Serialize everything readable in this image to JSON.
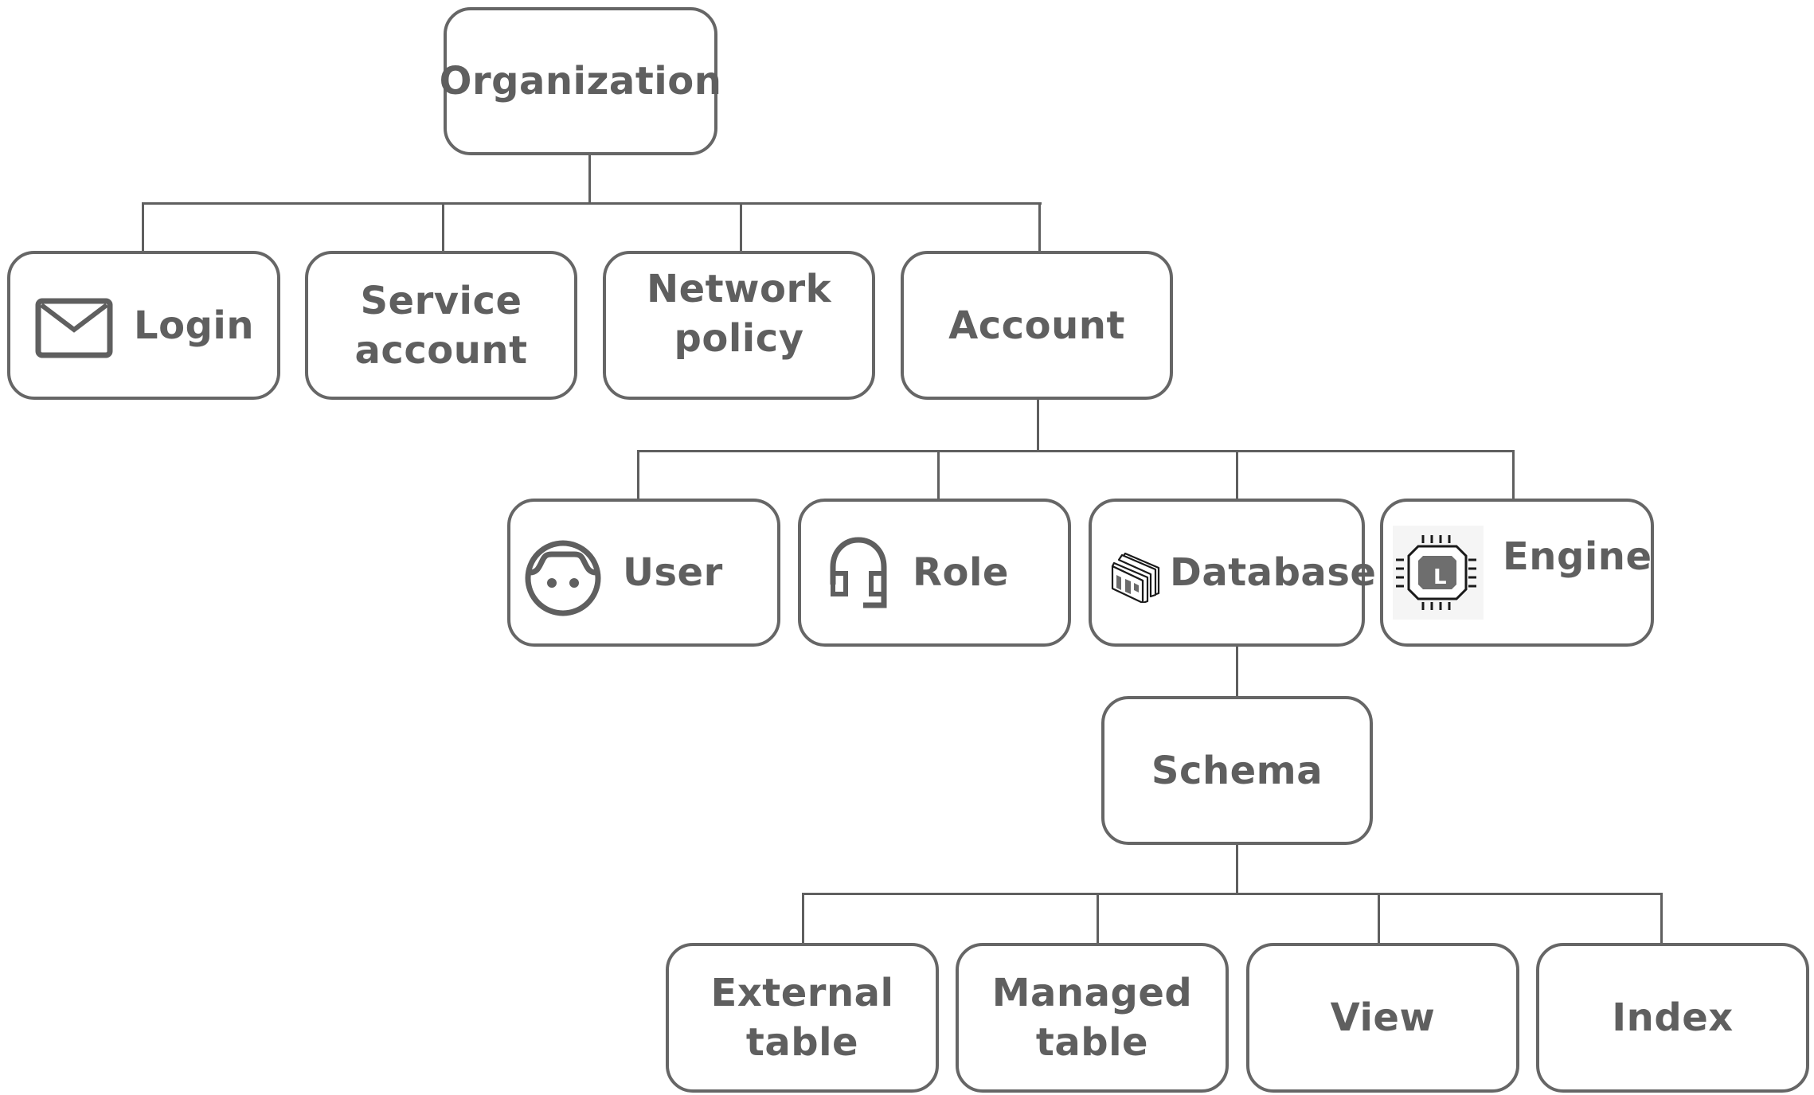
{
  "diagram": {
    "type": "hierarchy-tree",
    "colors": {
      "stroke": "#666666",
      "text": "#5f5f5f",
      "background": "#ffffff"
    },
    "nodes": {
      "organization": {
        "label": "Organization"
      },
      "login": {
        "label": "Login",
        "icon": "envelope-icon"
      },
      "service_account": {
        "label": "Service\naccount"
      },
      "network_policy": {
        "label": "Network\npolicy"
      },
      "account": {
        "label": "Account"
      },
      "user": {
        "label": "User",
        "icon": "user-face-icon"
      },
      "role": {
        "label": "Role",
        "icon": "headset-icon"
      },
      "database": {
        "label": "Database",
        "icon": "database-windows-icon"
      },
      "engine": {
        "label": "Engine",
        "icon": "chip-icon",
        "icon_letter": "L"
      },
      "schema": {
        "label": "Schema"
      },
      "external_table": {
        "label": "External\ntable"
      },
      "managed_table": {
        "label": "Managed\ntable"
      },
      "view": {
        "label": "View"
      },
      "index": {
        "label": "Index"
      }
    },
    "edges": [
      [
        "organization",
        "login"
      ],
      [
        "organization",
        "service_account"
      ],
      [
        "organization",
        "network_policy"
      ],
      [
        "organization",
        "account"
      ],
      [
        "account",
        "user"
      ],
      [
        "account",
        "role"
      ],
      [
        "account",
        "database"
      ],
      [
        "account",
        "engine"
      ],
      [
        "database",
        "schema"
      ],
      [
        "schema",
        "external_table"
      ],
      [
        "schema",
        "managed_table"
      ],
      [
        "schema",
        "view"
      ],
      [
        "schema",
        "index"
      ]
    ]
  }
}
